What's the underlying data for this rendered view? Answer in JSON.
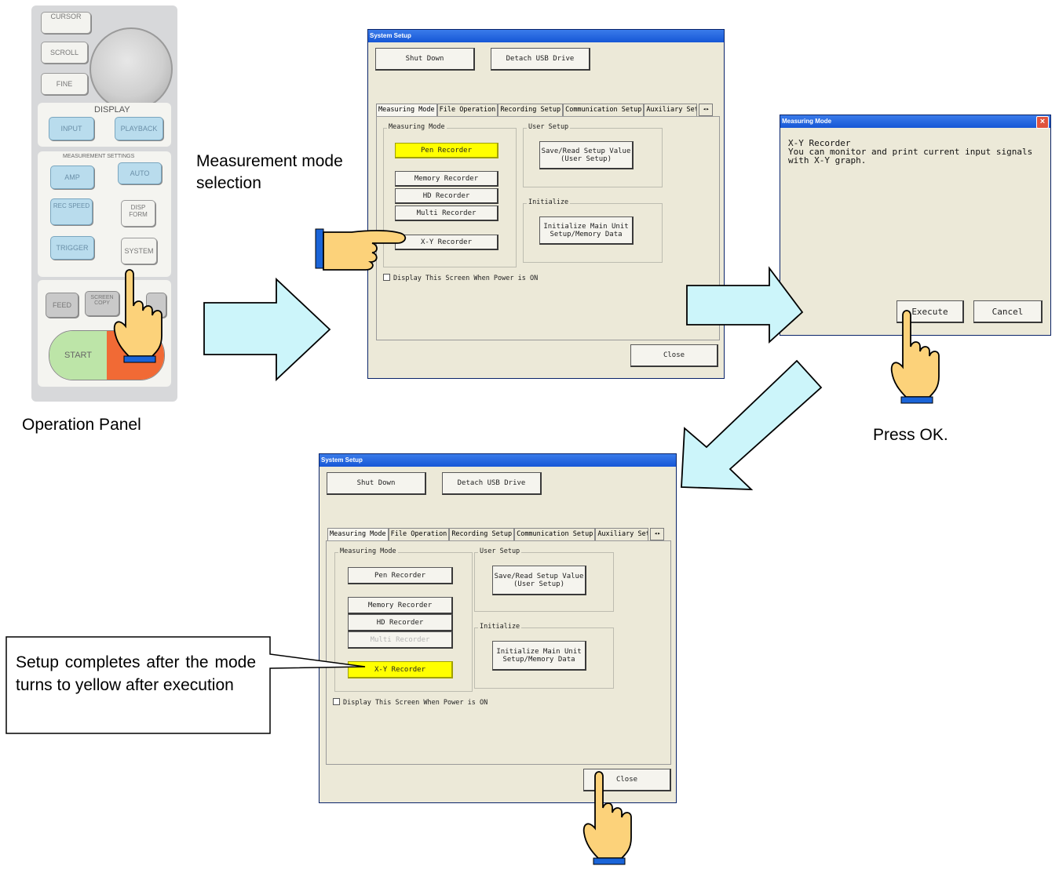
{
  "operation_panel": {
    "caption": "Operation Panel",
    "display_label": "DISPLAY",
    "buttons": {
      "cursor": "CURSOR",
      "scroll": "SCROLL",
      "fine": "FINE",
      "input": "INPUT",
      "playback": "PLAYBACK",
      "measurement_settings": "MEASUREMENT SETTINGS",
      "amp": "AMP",
      "auto": "AUTO",
      "rec_speed": "REC SPEED",
      "disp_form": "DISP FORM",
      "trigger": "TRIGGER",
      "system": "SYSTEM",
      "feed": "FEED",
      "screen_copy": "SCREEN COPY",
      "start": "START"
    }
  },
  "captions": {
    "measurement_mode_selection": "Measurement mode selection",
    "press_ok": "Press OK.",
    "callout": "Setup completes after the mode turns to yellow after execution"
  },
  "system_setup_top": {
    "title": "System Setup",
    "shut_down": "Shut Down",
    "detach_usb": "Detach USB Drive",
    "tabs": [
      "Measuring Mode",
      "File Operation",
      "Recording Setup",
      "Communication Setup",
      "Auxiliary Setup"
    ],
    "tab_scroll_left": "◂",
    "tab_scroll_right": "▸",
    "measuring_mode_group": "Measuring Mode",
    "modes": [
      "Pen Recorder",
      "Memory Recorder",
      "HD Recorder",
      "Multi Recorder",
      "X-Y Recorder"
    ],
    "selected_mode": "Pen Recorder",
    "user_setup_group": "User Setup",
    "save_read_line1": "Save/Read Setup Value",
    "save_read_line2": "(User Setup)",
    "initialize_group": "Initialize",
    "init_line1": "Initialize Main Unit",
    "init_line2": "Setup/Memory Data",
    "display_checkbox": "Display This Screen When Power is ON",
    "close": "Close"
  },
  "measuring_mode_dialog": {
    "title": "Measuring Mode",
    "close_icon": "×",
    "line1": "X-Y Recorder",
    "line2": "You can monitor and print current input signals",
    "line3": "with X-Y graph.",
    "execute": "Execute",
    "cancel": "Cancel"
  },
  "system_setup_bottom": {
    "title": "System Setup",
    "shut_down": "Shut Down",
    "detach_usb": "Detach USB Drive",
    "tabs": [
      "Measuring Mode",
      "File Operation",
      "Recording Setup",
      "Communication Setup",
      "Auxiliary Setup"
    ],
    "tab_scroll_left": "◂",
    "tab_scroll_right": "▸",
    "measuring_mode_group": "Measuring Mode",
    "modes": [
      "Pen Recorder",
      "Memory Recorder",
      "HD Recorder",
      "Multi Recorder",
      "X-Y Recorder"
    ],
    "selected_mode": "X-Y Recorder",
    "disabled_mode": "Multi Recorder",
    "user_setup_group": "User Setup",
    "save_read_line1": "Save/Read Setup Value",
    "save_read_line2": "(User Setup)",
    "initialize_group": "Initialize",
    "init_line1": "Initialize Main Unit",
    "init_line2": "Setup/Memory Data",
    "display_checkbox": "Display This Screen When Power is ON",
    "close": "Close"
  },
  "colors": {
    "arrow_fill": "#ccf5fa",
    "hand_fill": "#fcd27a",
    "cuff": "#1a64d8",
    "selected_mode": "#ffff00",
    "titlebar": "#1f62dd"
  }
}
